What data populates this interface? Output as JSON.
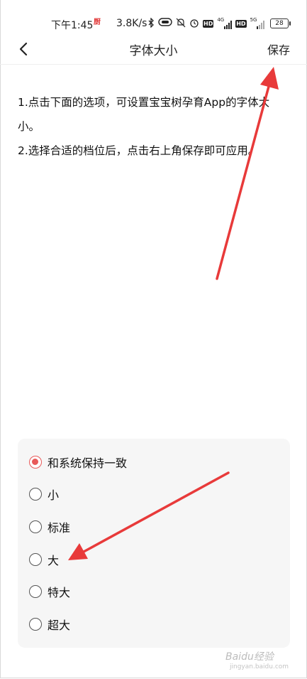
{
  "status_bar": {
    "time": "下午1:45",
    "carrier_icon": "厨",
    "net_speed": "3.8K/s",
    "icons": [
      "bluetooth-icon",
      "hd-icon",
      "mute-icon",
      "alarm-icon",
      "signal-icon",
      "wifi-icon"
    ],
    "hd_label": "HD",
    "net_4g": "4G",
    "net_5g": "5G",
    "battery": "28"
  },
  "header": {
    "title": "字体大小",
    "save_label": "保存"
  },
  "description": {
    "line1": "1.点击下面的选项，可设置宝宝树孕育App的字体大小。",
    "line2": "2.选择合适的档位后，点击右上角保存即可应用。"
  },
  "options": [
    {
      "label": "和系统保持一致",
      "selected": true
    },
    {
      "label": "小",
      "selected": false
    },
    {
      "label": "标准",
      "selected": false
    },
    {
      "label": "大",
      "selected": false
    },
    {
      "label": "特大",
      "selected": false
    },
    {
      "label": "超大",
      "selected": false
    }
  ],
  "colors": {
    "accent": "#e85a5a",
    "annotation_arrow": "#e83a3a"
  },
  "watermark": {
    "text": "Baidu经验",
    "sub": "jingyan.baidu.com"
  }
}
